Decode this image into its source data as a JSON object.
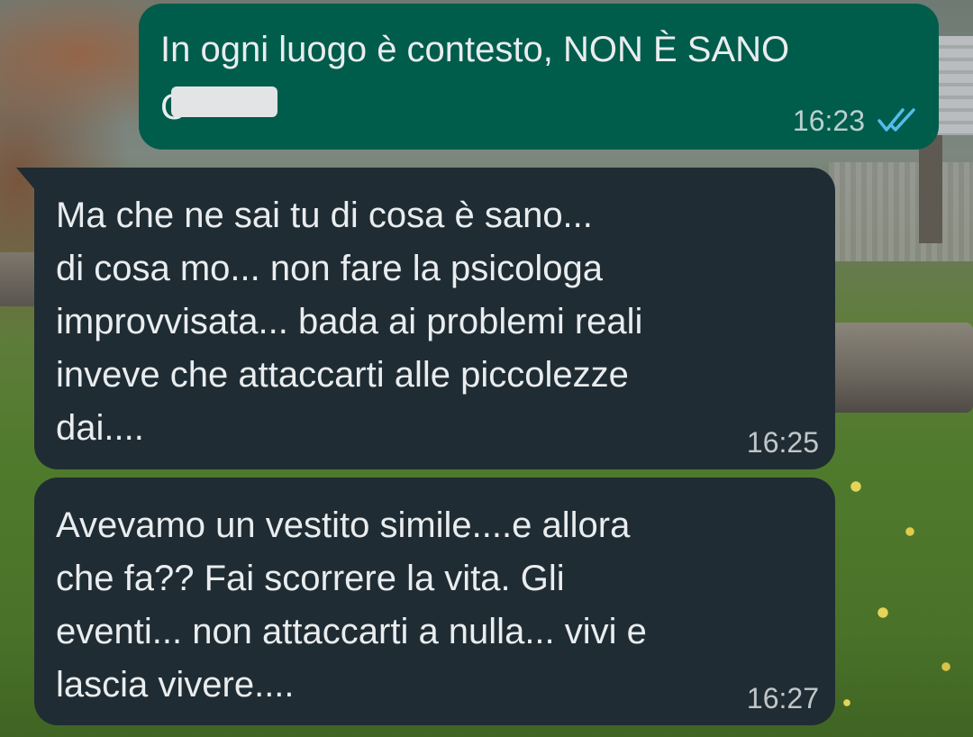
{
  "messages": [
    {
      "direction": "outgoing",
      "text": "In ogni luogo è contesto, NON È SANO",
      "redacted_fragment": "C",
      "time": "16:23",
      "status_icon": "double-check-read-icon",
      "status_color": "#53bdeb"
    },
    {
      "direction": "incoming",
      "text": "Ma che ne sai tu di cosa è sano...\ndi cosa mo... non fare la psicologa\nimprovvisata... bada ai problemi reali\ninveve che attaccarti alle piccolezze\ndai....",
      "time": "16:25"
    },
    {
      "direction": "incoming",
      "text": "Avevamo un vestito simile....e allora\nche fa?? Fai scorrere la vita.   Gli\neventi... non attaccarti a nulla... vivi e\nlascia vivere....",
      "time": "16:27"
    }
  ],
  "colors": {
    "outgoing_bubble": "#005c4b",
    "incoming_bubble": "#202c33",
    "text": "#e9edef"
  }
}
